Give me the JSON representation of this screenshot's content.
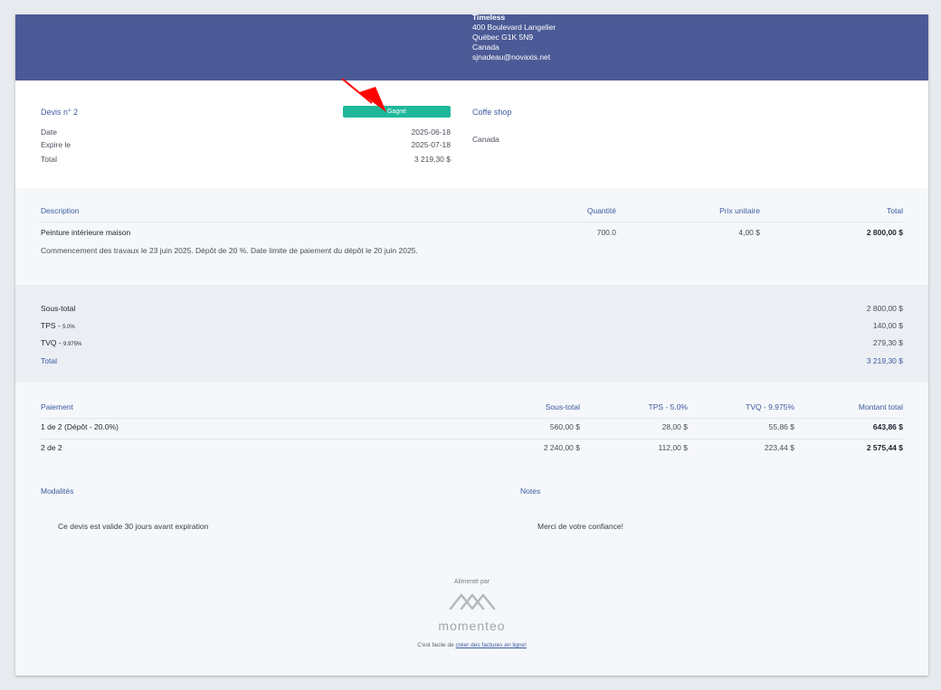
{
  "company": {
    "name": "Timeless",
    "address": "400 Boulevard Langelier",
    "city": "Québec G1K 5N9",
    "country": "Canada",
    "email": "sjnadeau@novaxis.net"
  },
  "quote": {
    "number_label": "Devis n° 2",
    "status": "Gagné",
    "date_label": "Date",
    "date_value": "2025-06-18",
    "expires_label": "Expire le",
    "expires_value": "2025-07-18",
    "total_label": "Total",
    "total_value": "3 219,30 $"
  },
  "client": {
    "name": "Coffe shop",
    "country": "Canada"
  },
  "items_table": {
    "headers": {
      "description": "Description",
      "quantity": "Quantité",
      "unit_price": "Prix unitaire",
      "total": "Total"
    },
    "rows": [
      {
        "name": "Peinture intérieure maison",
        "quantity": "700.0",
        "unit_price": "4,00 $",
        "total": "2 800,00 $",
        "note": "Commencement des travaux le 23 juin 2025. Dépôt de 20 %. Date limite de paiement du dépôt le 20 juin 2025."
      }
    ]
  },
  "totals": {
    "subtotal_label": "Sous-total",
    "subtotal_value": "2 800,00 $",
    "tps_label": "TPS - ",
    "tps_rate": "5.0%",
    "tps_value": "140,00 $",
    "tvq_label": "TVQ - ",
    "tvq_rate": "9.975%",
    "tvq_value": "279,30 $",
    "total_label": "Total",
    "total_value": "3 219,30 $"
  },
  "payments": {
    "headers": {
      "payment": "Paiement",
      "subtotal": "Sous-total",
      "tps": "TPS - 5.0%",
      "tvq": "TVQ - 9.975%",
      "total": "Montant total"
    },
    "rows": [
      {
        "label": "1 de 2 (Dépôt - 20.0%)",
        "subtotal": "560,00 $",
        "tps": "28,00 $",
        "tvq": "55,86 $",
        "total": "643,86 $"
      },
      {
        "label": "2 de 2",
        "subtotal": "2 240,00 $",
        "tps": "112,00 $",
        "tvq": "223,44 $",
        "total": "2 575,44 $"
      }
    ]
  },
  "terms": {
    "label": "Modalités",
    "text": "Ce devis est valide 30 jours avant expiration"
  },
  "notes": {
    "label": "Notes",
    "text": "Merci de votre confiance!"
  },
  "footer": {
    "powered_by": "Alimenté par",
    "brand": "momenteo",
    "line_prefix": "C'est facile de ",
    "link_text": "créer des factures en ligne!"
  },
  "colors": {
    "header_band": "#4b5a96",
    "status_badge": "#20b89a",
    "accent_text": "#3c5aa0",
    "annotation_arrow": "#ff0000"
  }
}
